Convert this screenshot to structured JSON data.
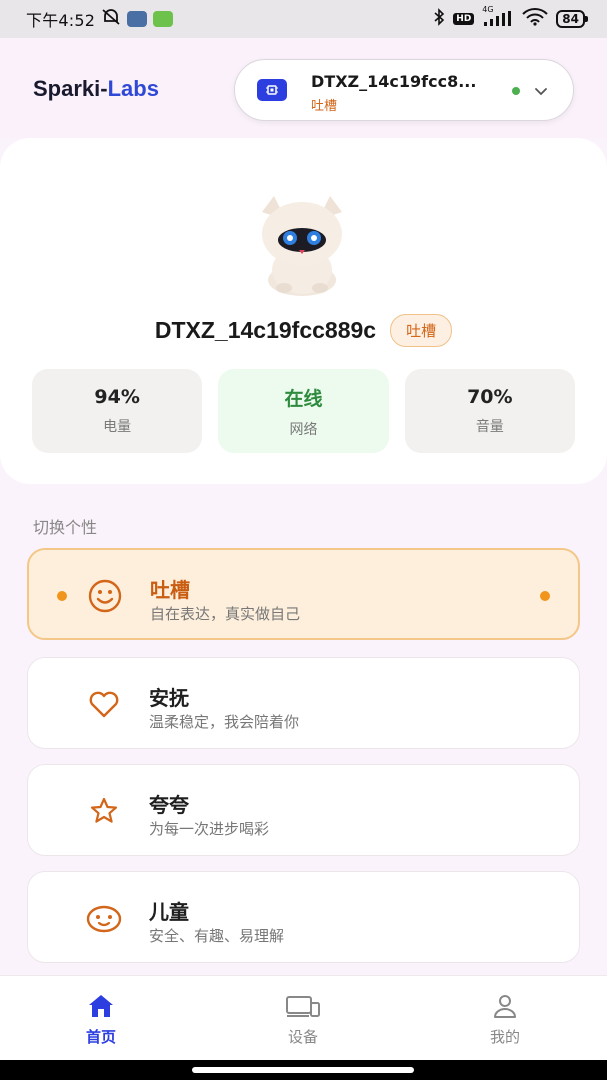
{
  "status_bar": {
    "time": "下午4:52",
    "network_label": "4G",
    "battery": "84"
  },
  "header": {
    "brand_part1": "Sparki-",
    "brand_part2": "Labs",
    "device_selector": {
      "name": "DTXZ_14c19fcc8...",
      "mode": "吐槽",
      "status": "online"
    }
  },
  "device_card": {
    "device_name": "DTXZ_14c19fcc889c",
    "mode_badge": "吐槽",
    "stats": [
      {
        "value": "94%",
        "label": "电量"
      },
      {
        "value": "在线",
        "label": "网络"
      },
      {
        "value": "70%",
        "label": "音量"
      }
    ]
  },
  "personality": {
    "section_label": "切换个性",
    "modes": [
      {
        "title": "吐槽",
        "desc": "自在表达，真实做自己",
        "icon": "smile-icon",
        "active": true
      },
      {
        "title": "安抚",
        "desc": "温柔稳定，我会陪着你",
        "icon": "heart-icon",
        "active": false
      },
      {
        "title": "夸夸",
        "desc": "为每一次进步喝彩",
        "icon": "star-icon",
        "active": false
      },
      {
        "title": "儿童",
        "desc": "安全、有趣、易理解",
        "icon": "child-face-icon",
        "active": false
      }
    ]
  },
  "bottom_nav": [
    {
      "label": "首页",
      "icon": "home-icon",
      "active": true
    },
    {
      "label": "设备",
      "icon": "devices-icon",
      "active": false
    },
    {
      "label": "我的",
      "icon": "profile-icon",
      "active": false
    }
  ],
  "colors": {
    "accent_blue": "#2c3ee0",
    "accent_orange": "#d2661a",
    "online_green": "#4caf50"
  }
}
